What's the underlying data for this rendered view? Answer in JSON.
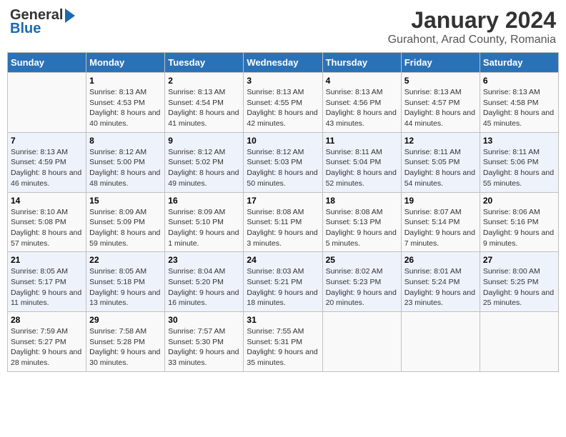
{
  "logo": {
    "general": "General",
    "blue": "Blue"
  },
  "title": "January 2024",
  "subtitle": "Gurahont, Arad County, Romania",
  "weekdays": [
    "Sunday",
    "Monday",
    "Tuesday",
    "Wednesday",
    "Thursday",
    "Friday",
    "Saturday"
  ],
  "weeks": [
    [
      {
        "day": "",
        "sunrise": "",
        "sunset": "",
        "daylight": ""
      },
      {
        "day": "1",
        "sunrise": "Sunrise: 8:13 AM",
        "sunset": "Sunset: 4:53 PM",
        "daylight": "Daylight: 8 hours and 40 minutes."
      },
      {
        "day": "2",
        "sunrise": "Sunrise: 8:13 AM",
        "sunset": "Sunset: 4:54 PM",
        "daylight": "Daylight: 8 hours and 41 minutes."
      },
      {
        "day": "3",
        "sunrise": "Sunrise: 8:13 AM",
        "sunset": "Sunset: 4:55 PM",
        "daylight": "Daylight: 8 hours and 42 minutes."
      },
      {
        "day": "4",
        "sunrise": "Sunrise: 8:13 AM",
        "sunset": "Sunset: 4:56 PM",
        "daylight": "Daylight: 8 hours and 43 minutes."
      },
      {
        "day": "5",
        "sunrise": "Sunrise: 8:13 AM",
        "sunset": "Sunset: 4:57 PM",
        "daylight": "Daylight: 8 hours and 44 minutes."
      },
      {
        "day": "6",
        "sunrise": "Sunrise: 8:13 AM",
        "sunset": "Sunset: 4:58 PM",
        "daylight": "Daylight: 8 hours and 45 minutes."
      }
    ],
    [
      {
        "day": "7",
        "sunrise": "Sunrise: 8:13 AM",
        "sunset": "Sunset: 4:59 PM",
        "daylight": "Daylight: 8 hours and 46 minutes."
      },
      {
        "day": "8",
        "sunrise": "Sunrise: 8:12 AM",
        "sunset": "Sunset: 5:00 PM",
        "daylight": "Daylight: 8 hours and 48 minutes."
      },
      {
        "day": "9",
        "sunrise": "Sunrise: 8:12 AM",
        "sunset": "Sunset: 5:02 PM",
        "daylight": "Daylight: 8 hours and 49 minutes."
      },
      {
        "day": "10",
        "sunrise": "Sunrise: 8:12 AM",
        "sunset": "Sunset: 5:03 PM",
        "daylight": "Daylight: 8 hours and 50 minutes."
      },
      {
        "day": "11",
        "sunrise": "Sunrise: 8:11 AM",
        "sunset": "Sunset: 5:04 PM",
        "daylight": "Daylight: 8 hours and 52 minutes."
      },
      {
        "day": "12",
        "sunrise": "Sunrise: 8:11 AM",
        "sunset": "Sunset: 5:05 PM",
        "daylight": "Daylight: 8 hours and 54 minutes."
      },
      {
        "day": "13",
        "sunrise": "Sunrise: 8:11 AM",
        "sunset": "Sunset: 5:06 PM",
        "daylight": "Daylight: 8 hours and 55 minutes."
      }
    ],
    [
      {
        "day": "14",
        "sunrise": "Sunrise: 8:10 AM",
        "sunset": "Sunset: 5:08 PM",
        "daylight": "Daylight: 8 hours and 57 minutes."
      },
      {
        "day": "15",
        "sunrise": "Sunrise: 8:09 AM",
        "sunset": "Sunset: 5:09 PM",
        "daylight": "Daylight: 8 hours and 59 minutes."
      },
      {
        "day": "16",
        "sunrise": "Sunrise: 8:09 AM",
        "sunset": "Sunset: 5:10 PM",
        "daylight": "Daylight: 9 hours and 1 minute."
      },
      {
        "day": "17",
        "sunrise": "Sunrise: 8:08 AM",
        "sunset": "Sunset: 5:11 PM",
        "daylight": "Daylight: 9 hours and 3 minutes."
      },
      {
        "day": "18",
        "sunrise": "Sunrise: 8:08 AM",
        "sunset": "Sunset: 5:13 PM",
        "daylight": "Daylight: 9 hours and 5 minutes."
      },
      {
        "day": "19",
        "sunrise": "Sunrise: 8:07 AM",
        "sunset": "Sunset: 5:14 PM",
        "daylight": "Daylight: 9 hours and 7 minutes."
      },
      {
        "day": "20",
        "sunrise": "Sunrise: 8:06 AM",
        "sunset": "Sunset: 5:16 PM",
        "daylight": "Daylight: 9 hours and 9 minutes."
      }
    ],
    [
      {
        "day": "21",
        "sunrise": "Sunrise: 8:05 AM",
        "sunset": "Sunset: 5:17 PM",
        "daylight": "Daylight: 9 hours and 11 minutes."
      },
      {
        "day": "22",
        "sunrise": "Sunrise: 8:05 AM",
        "sunset": "Sunset: 5:18 PM",
        "daylight": "Daylight: 9 hours and 13 minutes."
      },
      {
        "day": "23",
        "sunrise": "Sunrise: 8:04 AM",
        "sunset": "Sunset: 5:20 PM",
        "daylight": "Daylight: 9 hours and 16 minutes."
      },
      {
        "day": "24",
        "sunrise": "Sunrise: 8:03 AM",
        "sunset": "Sunset: 5:21 PM",
        "daylight": "Daylight: 9 hours and 18 minutes."
      },
      {
        "day": "25",
        "sunrise": "Sunrise: 8:02 AM",
        "sunset": "Sunset: 5:23 PM",
        "daylight": "Daylight: 9 hours and 20 minutes."
      },
      {
        "day": "26",
        "sunrise": "Sunrise: 8:01 AM",
        "sunset": "Sunset: 5:24 PM",
        "daylight": "Daylight: 9 hours and 23 minutes."
      },
      {
        "day": "27",
        "sunrise": "Sunrise: 8:00 AM",
        "sunset": "Sunset: 5:25 PM",
        "daylight": "Daylight: 9 hours and 25 minutes."
      }
    ],
    [
      {
        "day": "28",
        "sunrise": "Sunrise: 7:59 AM",
        "sunset": "Sunset: 5:27 PM",
        "daylight": "Daylight: 9 hours and 28 minutes."
      },
      {
        "day": "29",
        "sunrise": "Sunrise: 7:58 AM",
        "sunset": "Sunset: 5:28 PM",
        "daylight": "Daylight: 9 hours and 30 minutes."
      },
      {
        "day": "30",
        "sunrise": "Sunrise: 7:57 AM",
        "sunset": "Sunset: 5:30 PM",
        "daylight": "Daylight: 9 hours and 33 minutes."
      },
      {
        "day": "31",
        "sunrise": "Sunrise: 7:55 AM",
        "sunset": "Sunset: 5:31 PM",
        "daylight": "Daylight: 9 hours and 35 minutes."
      },
      {
        "day": "",
        "sunrise": "",
        "sunset": "",
        "daylight": ""
      },
      {
        "day": "",
        "sunrise": "",
        "sunset": "",
        "daylight": ""
      },
      {
        "day": "",
        "sunrise": "",
        "sunset": "",
        "daylight": ""
      }
    ]
  ]
}
